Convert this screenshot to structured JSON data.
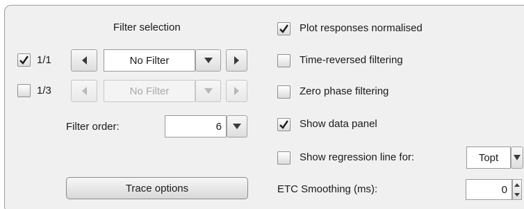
{
  "filter": {
    "title": "Filter selection",
    "octave_1_1": {
      "label": "1/1",
      "checked": true,
      "value": "No Filter"
    },
    "octave_1_3": {
      "label": "1/3",
      "checked": false,
      "value": "No Filter"
    },
    "order_label": "Filter order:",
    "order_value": "6",
    "trace_button": "Trace options"
  },
  "options": {
    "plot_normalised": {
      "label": "Plot responses normalised",
      "checked": true
    },
    "time_reversed": {
      "label": "Time-reversed filtering",
      "checked": false
    },
    "zero_phase": {
      "label": "Zero phase filtering",
      "checked": false
    },
    "show_data_panel": {
      "label": "Show data panel",
      "checked": true
    },
    "regression": {
      "label": "Show regression line for:",
      "checked": false,
      "value": "Topt"
    },
    "etc_smoothing": {
      "label": "ETC Smoothing (ms):",
      "value": "0"
    }
  }
}
